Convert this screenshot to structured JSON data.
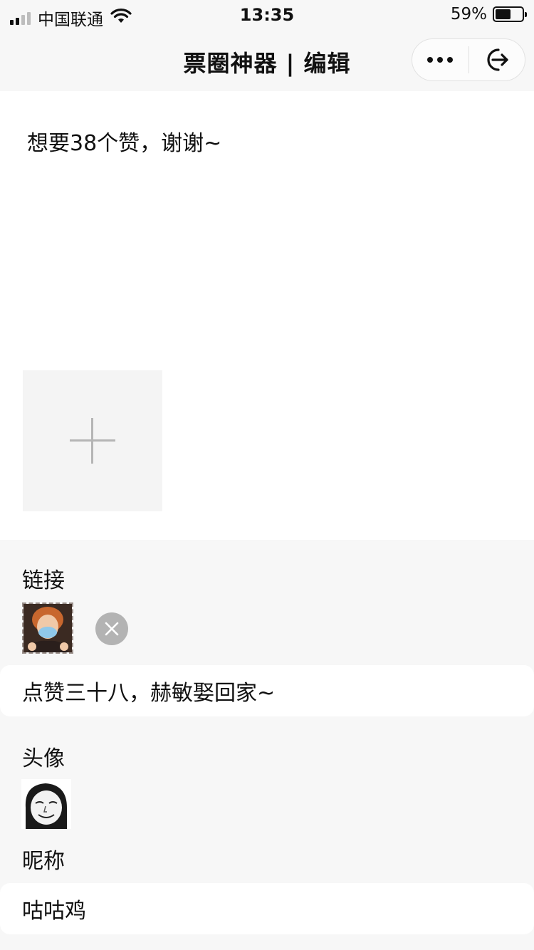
{
  "status_bar": {
    "carrier": "中国联通",
    "time": "13:35",
    "battery": "59%",
    "battery_level": 0.59
  },
  "nav": {
    "title": "票圈神器 | 编辑",
    "more_icon": "more-dots-icon",
    "exit_icon": "exit-icon"
  },
  "editor": {
    "text": "想要38个赞，谢谢~",
    "add_image_icon": "plus-icon"
  },
  "link": {
    "label": "链接",
    "thumbnail": "masked-person-image",
    "remove_icon": "close-icon",
    "title": "点赞三十八，赫敏娶回家~"
  },
  "profile": {
    "avatar_label": "头像",
    "avatar": "meme-face-avatar",
    "nickname_label": "昵称",
    "nickname": "咕咕鸡"
  }
}
